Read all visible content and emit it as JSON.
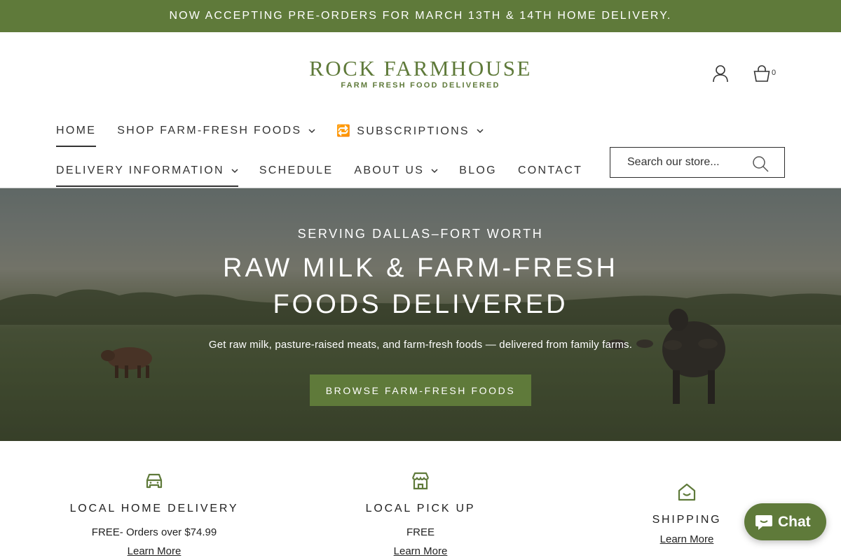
{
  "announcement": {
    "text": "NOW ACCEPTING PRE-ORDERS FOR MARCH 13TH & 14TH HOME DELIVERY."
  },
  "header": {
    "logo_main": "ROCK FARMHOUSE",
    "logo_sub": "FARM FRESH FOOD DELIVERED",
    "cart_count": "0",
    "icons": [
      "account-icon",
      "cart-icon"
    ]
  },
  "nav": {
    "row1": [
      {
        "label": "HOME",
        "dropdown": false,
        "active": true
      },
      {
        "label": "SHOP FARM-FRESH FOODS",
        "dropdown": true
      },
      {
        "label": "🔁 SUBSCRIPTIONS",
        "dropdown": true
      }
    ],
    "row2": [
      {
        "label": "DELIVERY INFORMATION",
        "dropdown": true,
        "active": true
      },
      {
        "label": "SCHEDULE",
        "dropdown": false
      },
      {
        "label": "ABOUT US",
        "dropdown": true
      },
      {
        "label": "BLOG",
        "dropdown": false
      },
      {
        "label": "CONTACT",
        "dropdown": false
      }
    ]
  },
  "search": {
    "placeholder": "Search our store..."
  },
  "hero": {
    "kicker": "SERVING DALLAS–FORT WORTH",
    "title": "RAW MILK & FARM-FRESH FOODS DELIVERED",
    "subtitle": "Get raw milk, pasture-raised meats, and farm-fresh foods — delivered from family farms.",
    "button": "BROWSE FARM-FRESH FOODS"
  },
  "features": [
    {
      "icon": "car-icon",
      "title": "LOCAL HOME DELIVERY",
      "text": "FREE- Orders over $74.99",
      "link": "Learn More"
    },
    {
      "icon": "store-icon",
      "title": "LOCAL PICK UP",
      "text": "FREE",
      "link": "Learn More"
    },
    {
      "icon": "home-icon",
      "title": "SHIPPING",
      "text": "",
      "link": "Learn More"
    }
  ],
  "chat": {
    "label": "Chat"
  },
  "colors": {
    "brand": "#5f7a3a",
    "text": "#222222"
  }
}
